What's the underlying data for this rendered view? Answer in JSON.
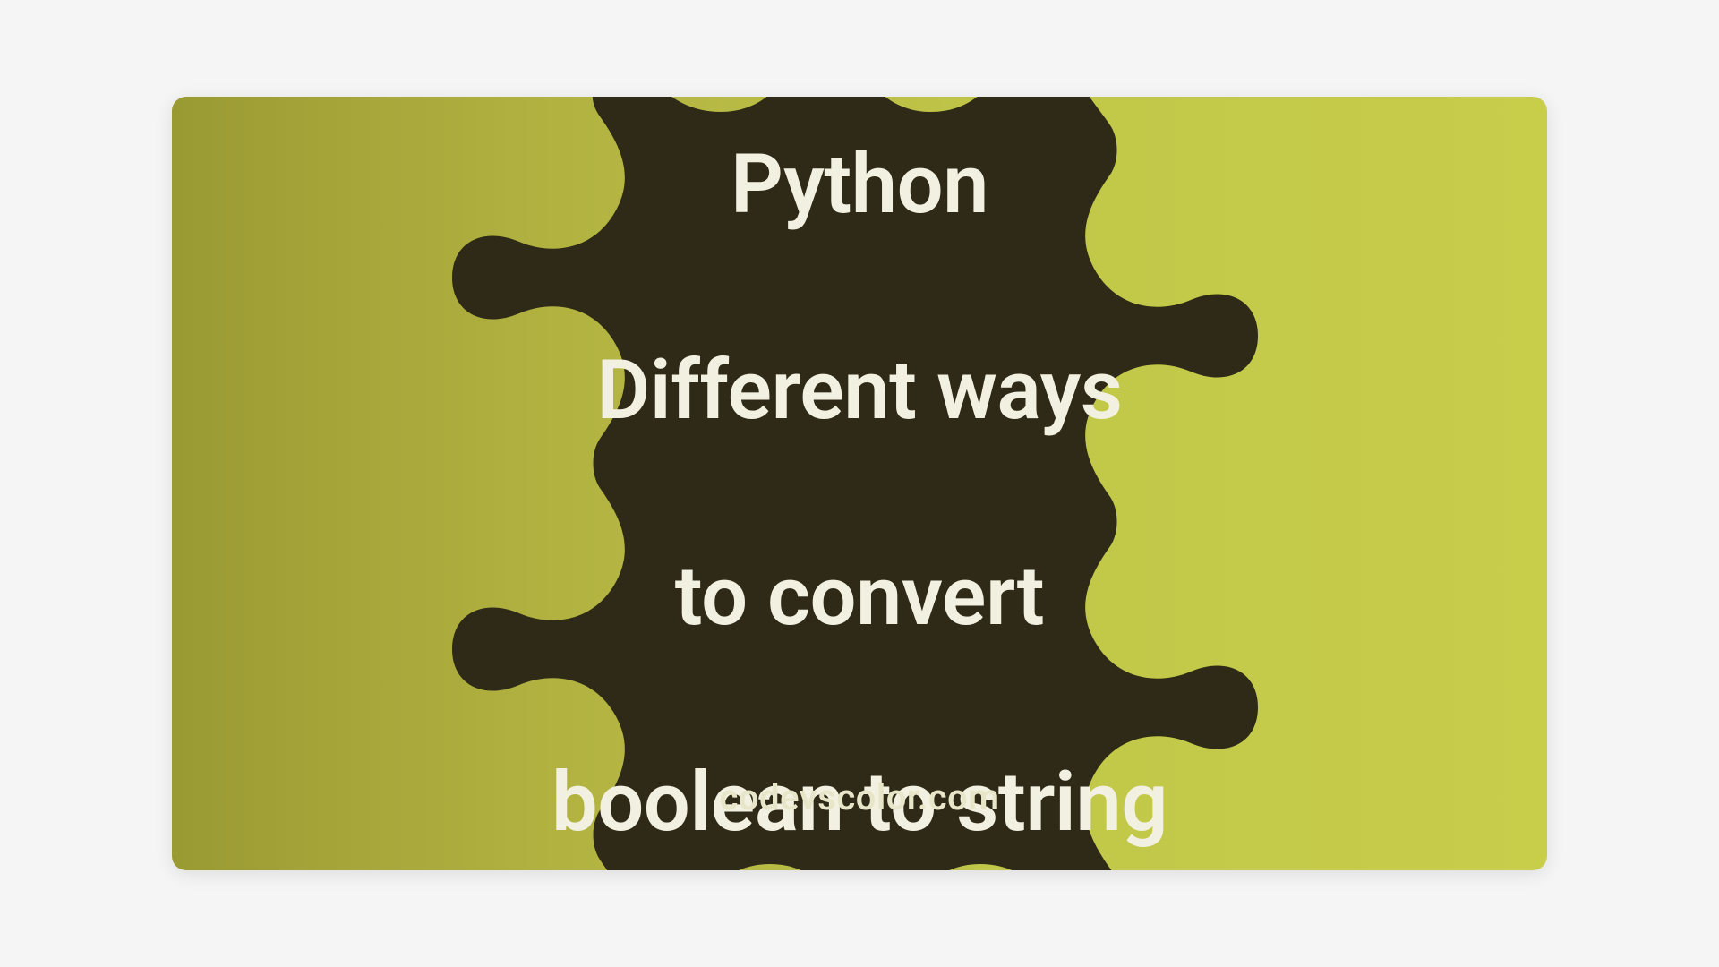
{
  "title": {
    "line1": "Python",
    "line2": "Different ways",
    "line3": "to convert",
    "line4": "boolean to string"
  },
  "domain": "codevscolor.com"
}
